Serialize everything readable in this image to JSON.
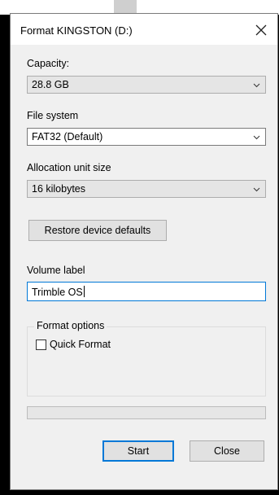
{
  "window": {
    "title": "Format KINGSTON (D:)"
  },
  "capacity": {
    "label": "Capacity:",
    "value": "28.8 GB"
  },
  "file_system": {
    "label": "File system",
    "value": "FAT32 (Default)"
  },
  "allocation_unit": {
    "label": "Allocation unit size",
    "value": "16 kilobytes"
  },
  "restore_button": {
    "label": "Restore device defaults"
  },
  "volume_label": {
    "label": "Volume label",
    "value": "Trimble OS"
  },
  "format_options": {
    "title": "Format options",
    "quick_format": {
      "label": "Quick Format",
      "checked": false
    }
  },
  "progress": {
    "percent": 0
  },
  "buttons": {
    "start": "Start",
    "close": "Close"
  },
  "icons": {
    "close": "close-icon",
    "dropdown": "chevron-down-icon"
  },
  "colors": {
    "accent": "#0078d7",
    "dialog_bg": "#f0f0f0"
  }
}
